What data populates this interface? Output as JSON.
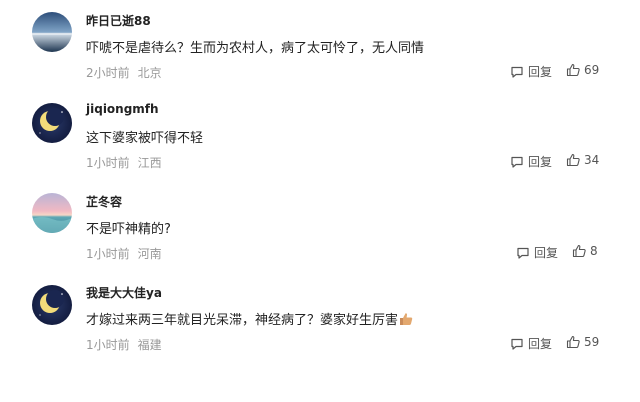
{
  "reply_label": "回复",
  "comments": [
    {
      "username": "昨日已逝88",
      "text": "吓唬不是虐待么？生而为农村人，病了太可怜了，无人同情",
      "time": "2小时前",
      "location": "北京",
      "likes": "69",
      "avatar_icon": "ocean-horizon-avatar"
    },
    {
      "username": "jiqiongmfh",
      "text": "这下婆家被吓得不轻",
      "time": "1小时前",
      "location": "江西",
      "likes": "34",
      "avatar_icon": "crescent-moon-avatar"
    },
    {
      "username": "芷冬容",
      "text": "不是吓神精的?",
      "time": "1小时前",
      "location": "河南",
      "likes": "8",
      "avatar_icon": "sunset-sea-avatar"
    },
    {
      "username": "我是大大佳ya",
      "text": "才嫁过来两三年就目光呆滞，神经病了？婆家好生厉害",
      "time": "1小时前",
      "location": "福建",
      "likes": "59",
      "avatar_icon": "crescent-moon-avatar",
      "trailing_emoji": "thumbs-up-emoji"
    }
  ]
}
